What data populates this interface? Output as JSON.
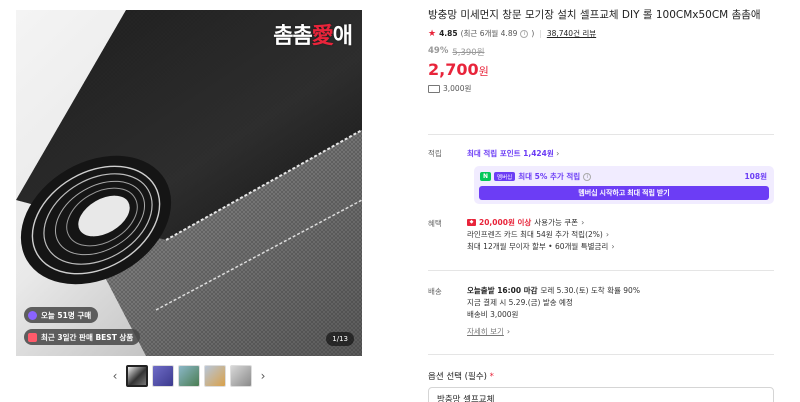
{
  "gallery": {
    "brand_logo": {
      "part1": "촘촘",
      "heart": "愛",
      "part2": "애"
    },
    "badges": [
      {
        "text": "오늘 51명 구매"
      },
      {
        "text": "최근 3일간 판매 BEST 상품"
      }
    ],
    "image_counter": "1/13",
    "thumbnails": [
      "thumb-1",
      "thumb-2",
      "thumb-3",
      "thumb-4",
      "thumb-5"
    ],
    "prev_icon": "‹",
    "next_icon": "›"
  },
  "product": {
    "title": "방충망 미세먼지 창문 모기장 설치 셀프교체 DIY 롤 100CMx50CM 촘촘애",
    "rating": "4.85",
    "rating_detail": "(최근 6개월 4.89",
    "rating_detail_end": ")",
    "review_count": "38,740건 리뷰",
    "discount": "49%",
    "original_price": "5,390원",
    "price": "2,700",
    "price_unit": "원",
    "shipping_fee": "3,000원"
  },
  "points": {
    "label": "적립",
    "max_points_link": "최대 적립 포인트 1,424원",
    "npay_badge": "N",
    "membership_badge": "멤버십",
    "extra_rate": "최대 5% 추가 적립",
    "extra_amount": "108원",
    "member_button": "멤버십 시작하고 최대 적립 받기"
  },
  "benefits": {
    "label": "혜택",
    "coupon_amount": "20,000원 이상",
    "coupon_text": "사용가능 쿠폰",
    "card_text": "라인프렌즈 카드 최대 54원 추가 적립(2%)",
    "installment_text": "최대 12개월 무이자 할부 • 60개월 특별금리"
  },
  "shipping": {
    "label": "배송",
    "today_ship": "오늘출발 16:00 마감",
    "arrival": "모레 5.30.(토) 도착 확률 90%",
    "order_now": "지금 결제 시 5.29.(금) 발송 예정",
    "fee": "배송비 3,000원",
    "detail_link": "자세히 보기"
  },
  "options": {
    "label": "옵션 선택 (필수)",
    "required_mark": "*",
    "selected": "방충망 셀프교체"
  },
  "colors": {
    "accent_red": "#e8243a",
    "accent_purple": "#6c3df5",
    "npay_green": "#03c75a"
  }
}
